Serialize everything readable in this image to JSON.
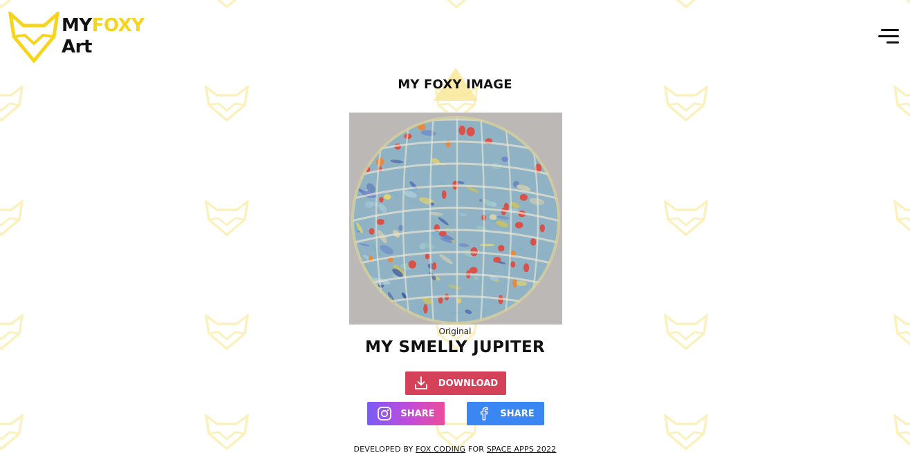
{
  "brand": {
    "name_part1": "MY",
    "name_part2": "FOXY",
    "name_part3": "Art",
    "logo_icon": "fox-head-outline-icon",
    "accent_color": "#f6d51f"
  },
  "header": {
    "menu_icon": "hamburger-menu-icon"
  },
  "main": {
    "section_title": "MY FOXY IMAGE",
    "artwork_caption": "Original",
    "artwork_title": "MY SMELLY JUPITER"
  },
  "actions": {
    "download_label": "DOWNLOAD",
    "download_icon": "download-icon",
    "download_color": "#d6415a",
    "instagram_share_label": "SHARE",
    "instagram_icon": "instagram-icon",
    "facebook_share_label": "SHARE",
    "facebook_icon": "facebook-icon",
    "facebook_color": "#3a86f2"
  },
  "footer": {
    "prefix": "DEVELOPED BY",
    "team_link": "FOX CODING",
    "middle": "FOR",
    "event_link": "SPACE APPS 2022"
  }
}
